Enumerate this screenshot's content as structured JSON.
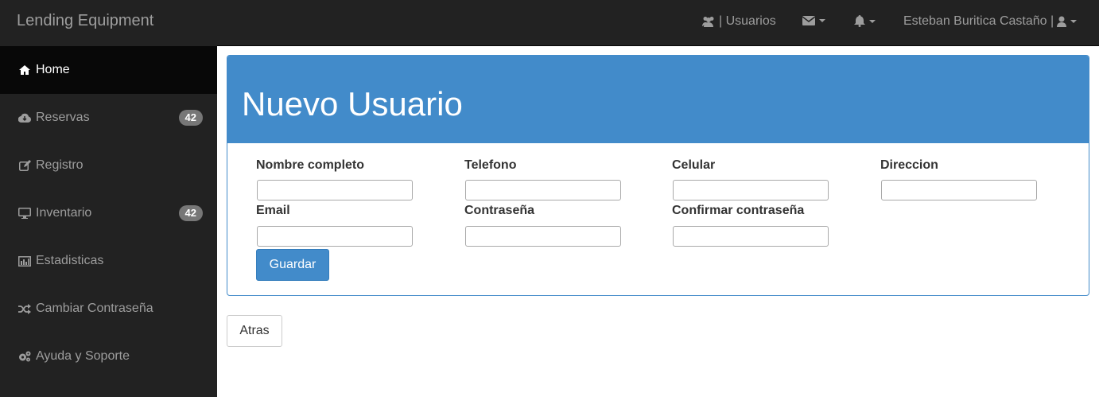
{
  "brand": "Lending Equipment",
  "topnav": {
    "users": "| Usuarios",
    "user_name": "Esteban Buritica Castaño |"
  },
  "sidebar": {
    "items": [
      {
        "label": "Home",
        "icon": "home-icon"
      },
      {
        "label": "Reservas",
        "icon": "cloud-download-icon",
        "badge": "42"
      },
      {
        "label": "Registro",
        "icon": "edit-icon"
      },
      {
        "label": "Inventario",
        "icon": "desktop-icon",
        "badge": "42"
      },
      {
        "label": "Estadisticas",
        "icon": "bar-chart-icon"
      },
      {
        "label": "Cambiar Contraseña",
        "icon": "random-icon"
      },
      {
        "label": "Ayuda y Soporte",
        "icon": "cogs-icon"
      }
    ]
  },
  "panel": {
    "title": "Nuevo Usuario"
  },
  "form": {
    "fields": [
      {
        "label": "Nombre completo",
        "value": ""
      },
      {
        "label": "Telefono",
        "value": ""
      },
      {
        "label": "Celular",
        "value": ""
      },
      {
        "label": "Direccion",
        "value": ""
      },
      {
        "label": "Email",
        "value": ""
      },
      {
        "label": "Contraseña",
        "value": ""
      },
      {
        "label": "Confirmar contraseña",
        "value": ""
      }
    ],
    "submit": "Guardar"
  },
  "back_button": "Atras",
  "colors": {
    "navbar": "#222222",
    "sidebar_active": "#080808",
    "primary": "#428bca",
    "badge": "#777777"
  }
}
